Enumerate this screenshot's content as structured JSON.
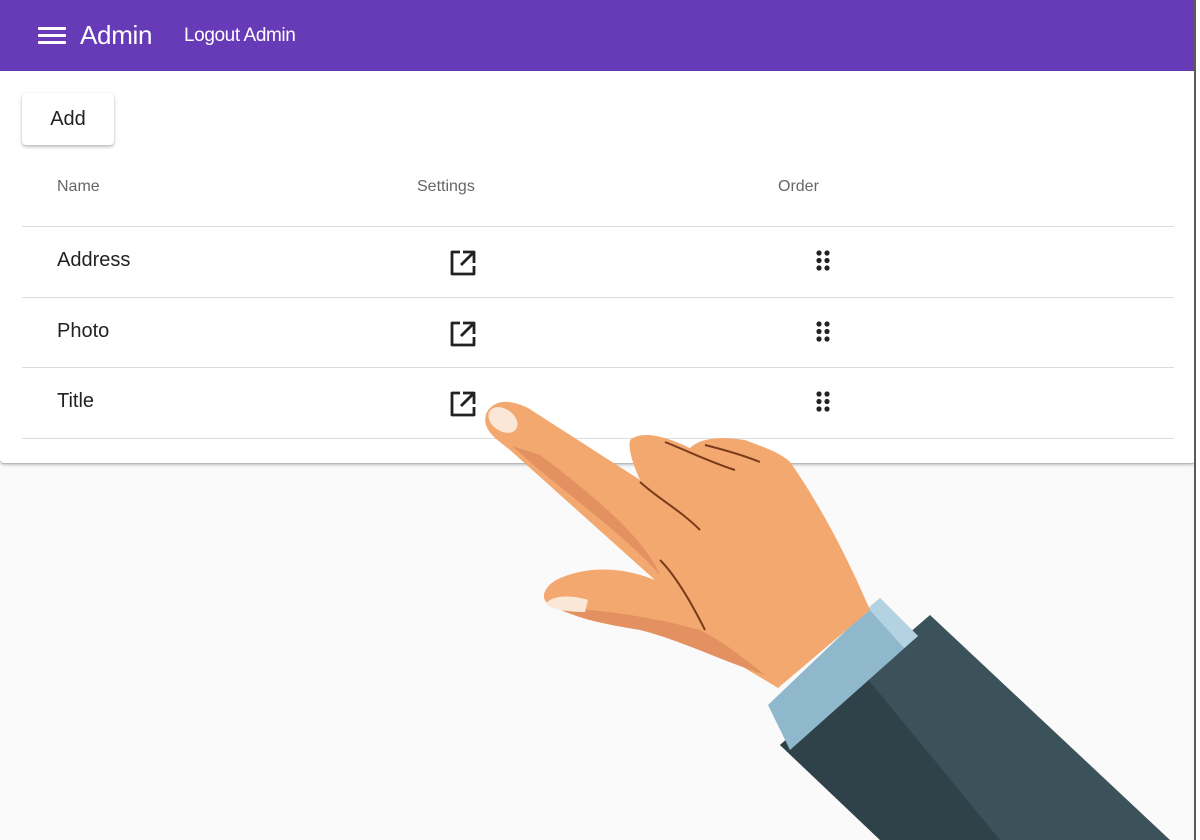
{
  "header": {
    "title": "Admin",
    "logout_label": "Logout Admin",
    "menu_icon": "hamburger-menu-icon",
    "background": "#673ab7"
  },
  "toolbar": {
    "add_label": "Add"
  },
  "table": {
    "columns": [
      "Name",
      "Settings",
      "Order"
    ],
    "rows": [
      {
        "name": "Address",
        "settings_icon": "open-in-new-icon",
        "order_icon": "drag-handle-icon"
      },
      {
        "name": "Photo",
        "settings_icon": "open-in-new-icon",
        "order_icon": "drag-handle-icon"
      },
      {
        "name": "Title",
        "settings_icon": "open-in-new-icon",
        "order_icon": "drag-handle-icon"
      }
    ]
  },
  "overlay": {
    "illustration": "pointing-hand",
    "skin_color": "#f3a86f",
    "cuff_color": "#8fb8cc",
    "sleeve_color": "#3b525a"
  }
}
